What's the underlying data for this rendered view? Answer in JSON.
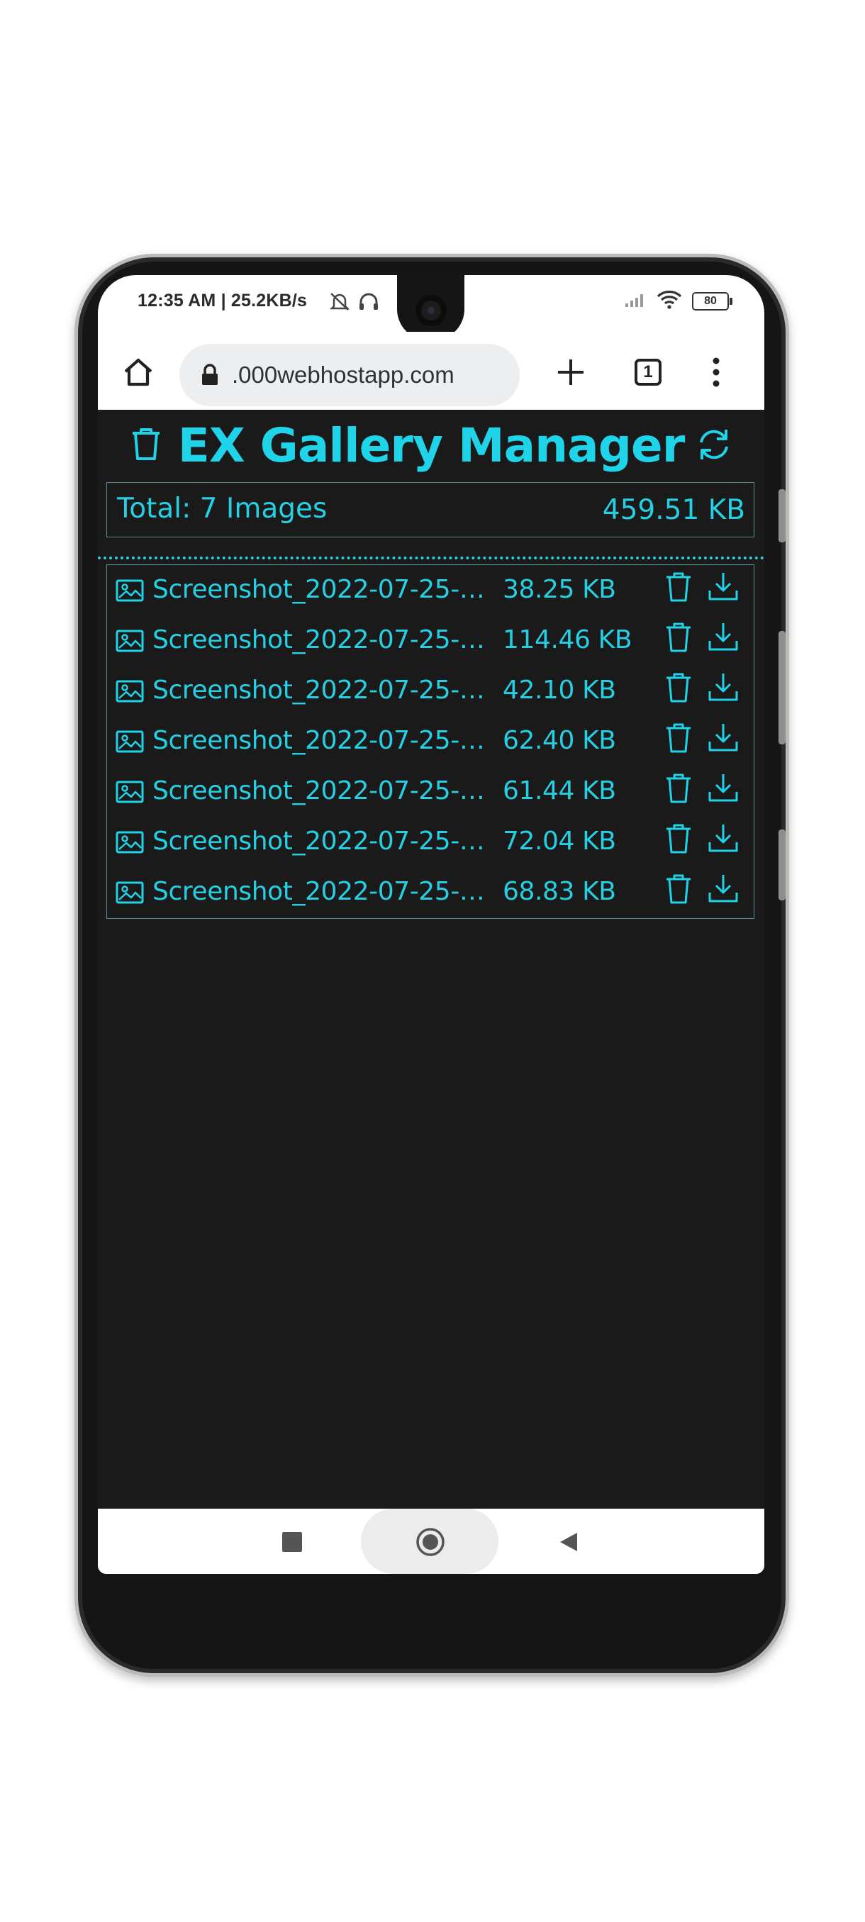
{
  "status_bar": {
    "time_speed": "12:35 AM | 25.2KB/s",
    "battery": "80",
    "icons": [
      "mute-alarm-icon",
      "headphones-icon",
      "signal-icon",
      "wifi-icon",
      "battery-icon"
    ]
  },
  "browser": {
    "url": ".000webhostapp.com",
    "tab_count": "1",
    "icons": [
      "home-icon",
      "lock-icon",
      "plus-icon",
      "tabs-icon",
      "more-vert-icon"
    ]
  },
  "app": {
    "title": "EX Gallery Manager",
    "total_label": "Total: 7 Images",
    "total_size": "459.51 KB",
    "accent_color": "#1fd4e8",
    "background_color": "#1a1a1a",
    "files": [
      {
        "name": "Screenshot_2022-07-25-…",
        "size": "38.25 KB"
      },
      {
        "name": "Screenshot_2022-07-25-…",
        "size": "114.46 KB"
      },
      {
        "name": "Screenshot_2022-07-25-…",
        "size": "42.10 KB"
      },
      {
        "name": "Screenshot_2022-07-25-…",
        "size": "62.40 KB"
      },
      {
        "name": "Screenshot_2022-07-25-…",
        "size": "61.44 KB"
      },
      {
        "name": "Screenshot_2022-07-25-…",
        "size": "72.04 KB"
      },
      {
        "name": "Screenshot_2022-07-25-…",
        "size": "68.83 KB"
      }
    ]
  },
  "nav_bar": {
    "icons": [
      "recents-icon",
      "home-circle-icon",
      "back-icon"
    ]
  }
}
